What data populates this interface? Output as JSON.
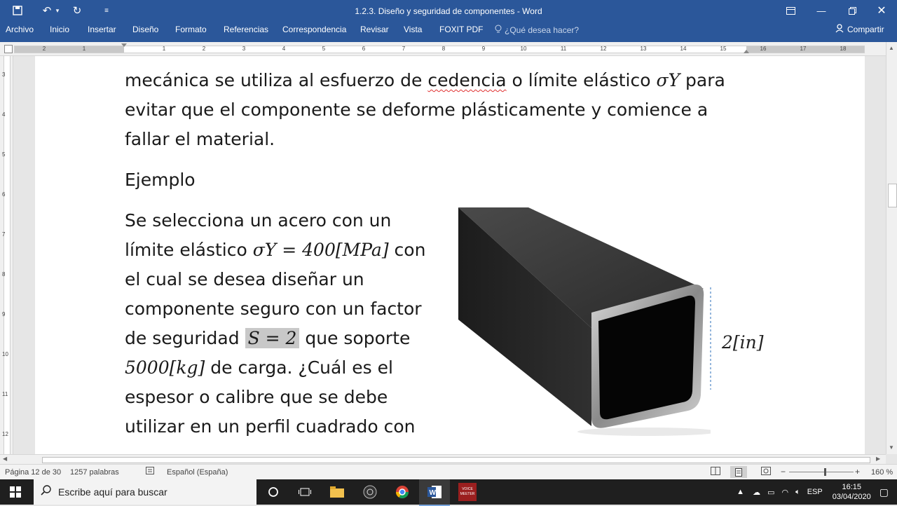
{
  "window": {
    "title": "1.2.3. Diseño y seguridad de componentes - Word"
  },
  "ribbon": {
    "tabs": [
      "Archivo",
      "Inicio",
      "Insertar",
      "Diseño",
      "Formato",
      "Referencias",
      "Correspondencia",
      "Revisar",
      "Vista",
      "FOXIT PDF"
    ],
    "tell_me": "¿Qué desea hacer?",
    "share": "Compartir"
  },
  "ruler": {
    "ticks": [
      "2",
      "1",
      "1",
      "2",
      "3",
      "4",
      "5",
      "6",
      "7",
      "8",
      "9",
      "10",
      "11",
      "12",
      "13",
      "14",
      "15",
      "16",
      "17",
      "18"
    ],
    "vticks": [
      "3",
      "4",
      "5",
      "6",
      "7",
      "8",
      "9",
      "10",
      "11",
      "12"
    ]
  },
  "document": {
    "p1_line1_pre": "mecánica se utiliza al esfuerzo de",
    "p1_line1_word": "cedencia",
    "p1_line1_post": "o límite elástico",
    "p1_line1_math": "σY",
    "p1_line1_end": "para",
    "p1_line2": "evitar que el componente se deforme plásticamente y comience a",
    "p1_line3": "fallar el material.",
    "heading": "Ejemplo",
    "ex_line1": "Se selecciona un acero con un",
    "ex_line2_pre": "límite elástico",
    "ex_line2_math": "σY = 400[MPa]",
    "ex_line2_post": "con",
    "ex_line3": "el cual se desea diseñar un",
    "ex_line4": "componente seguro con un factor",
    "ex_line5_pre": "de seguridad",
    "ex_line5_math": "S = 2",
    "ex_line5_post": "que soporte",
    "ex_line6_math": "5000[kg]",
    "ex_line6_post": "de carga. ¿Cuál es el",
    "ex_line7": "espesor o calibre que se debe",
    "ex_line8": "utilizar en un perfil cuadrado con",
    "dimension_label": "2[in]"
  },
  "statusbar": {
    "page": "Página 12 de 30",
    "words": "1257 palabras",
    "language": "Español (España)",
    "zoom": "160 %"
  },
  "taskbar": {
    "search_placeholder": "Escribe aquí para buscar",
    "voice_label": "VOICE MEETER",
    "lang": "ESP",
    "time": "16:15",
    "date": "03/04/2020"
  }
}
